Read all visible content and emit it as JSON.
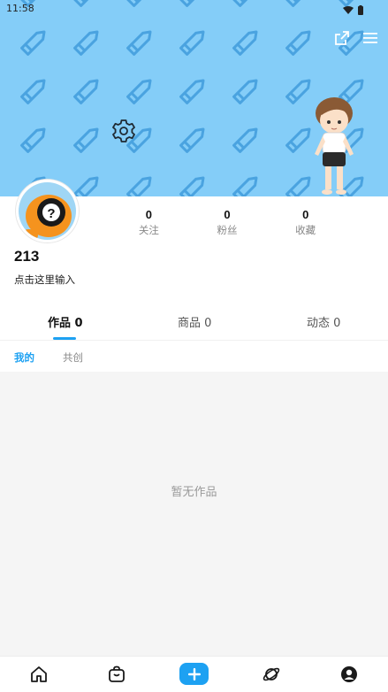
{
  "status_bar": {
    "time": "11:58"
  },
  "profile": {
    "username": "213",
    "bio": "点击这里输入",
    "stats": [
      {
        "value": "0",
        "label": "关注"
      },
      {
        "value": "0",
        "label": "粉丝"
      },
      {
        "value": "0",
        "label": "收藏"
      }
    ]
  },
  "tabs": [
    {
      "label": "作品 0",
      "active": true
    },
    {
      "label": "商品 0",
      "active": false
    },
    {
      "label": "动态 0",
      "active": false
    }
  ],
  "subtabs": [
    {
      "label": "我的",
      "active": true
    },
    {
      "label": "共创",
      "active": false
    }
  ],
  "empty_state": {
    "text": "暂无作品"
  },
  "bottom_nav": [
    {
      "icon": "home-icon"
    },
    {
      "icon": "shopping-bag-icon"
    },
    {
      "icon": "add-icon"
    },
    {
      "icon": "planet-icon"
    },
    {
      "icon": "user-icon"
    }
  ],
  "colors": {
    "accent": "#1da1f2",
    "banner": "#84cdf8",
    "pencil": "#4aa3e0"
  }
}
